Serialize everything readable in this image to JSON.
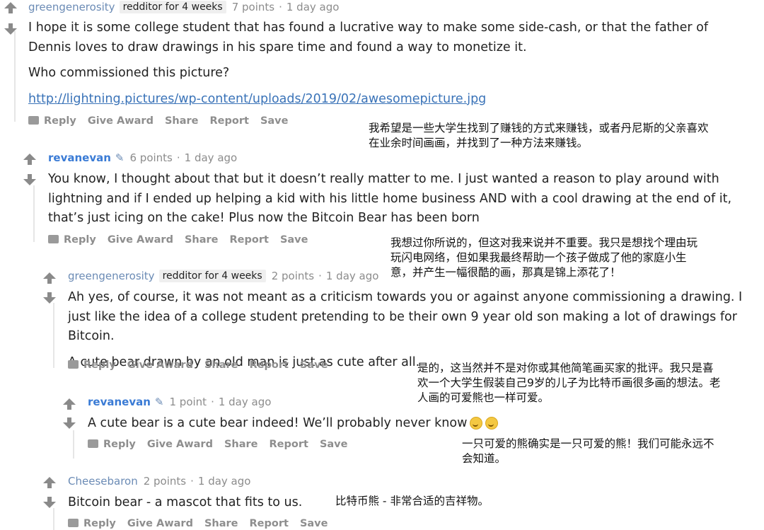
{
  "comments": [
    {
      "author": "greengenerosity",
      "flair": "redditor for 4 weeks",
      "points": "7 points",
      "time": "1 day ago",
      "paragraphs": [
        "I hope it is some college student that has found a lucrative way to make some side-cash, or that the father of Dennis loves to draw drawings in his spare time and found a way to monetize it.",
        "Who commissioned this picture?"
      ],
      "link": "http://lightning.pictures/wp-content/uploads/2019/02/awesomepicture.jpg",
      "translation": "我希望是一些大学生找到了赚钱的方式来赚钱，或者丹尼斯的父亲喜欢在业余时间画画，并找到了一种方法来赚钱。"
    },
    {
      "author": "revanevan",
      "points": "6 points",
      "time": "1 day ago",
      "paragraphs": [
        "You know, I thought about that but it doesn’t really matter to me. I just wanted a reason to play around with lightning and if I ended up helping a kid with his little home business AND with a cool drawing at the end of it, that’s just icing on the cake! Plus now the Bitcoin Bear has been born"
      ],
      "translation": "我想过你所说的，但这对我来说并不重要。我只是想找个理由玩玩闪电网络，但如果我最终帮助一个孩子做成了他的家庭小生意，并产生一幅很酷的画，那真是锦上添花了！"
    },
    {
      "author": "greengenerosity",
      "flair": "redditor for 4 weeks",
      "points": "2 points",
      "time": "1 day ago",
      "paragraphs": [
        "Ah yes, of course, it was not meant as a criticism towards you or against anyone commissioning a drawing. I just like the idea of a college student pretending to be their own 9 year old son making a lot of drawings for Bitcoin.",
        "A cute bear drawn by an old man is just as cute after all."
      ],
      "translation": "是的，这当然并不是对你或其他简笔画买家的批评。我只是喜欢一个大学生假装自己9岁的儿子为比特币画很多画的想法。老人画的可爱熊也一样可爱。"
    },
    {
      "author": "revanevan",
      "points": "1 point",
      "time": "1 day ago",
      "paragraphs": [
        "A cute bear is a cute bear indeed! We’ll probably never know"
      ],
      "translation": "一只可爱的熊确实是一只可爱的熊！我们可能永远不会知道。"
    },
    {
      "author": "Cheesebaron",
      "points": "2 points",
      "time": "1 day ago",
      "paragraphs": [
        "Bitcoin bear - a mascot that fits to us."
      ],
      "translation": "比特币熊 - 非常合适的吉祥物。"
    }
  ],
  "actions": {
    "reply": "Reply",
    "give_award": "Give Award",
    "share": "Share",
    "report": "Report",
    "save": "Save"
  },
  "colors": {
    "author": "#6b8bb5",
    "meta": "#8c8c8c",
    "action": "#8e8e8e",
    "vote": "#8a8a8a"
  }
}
